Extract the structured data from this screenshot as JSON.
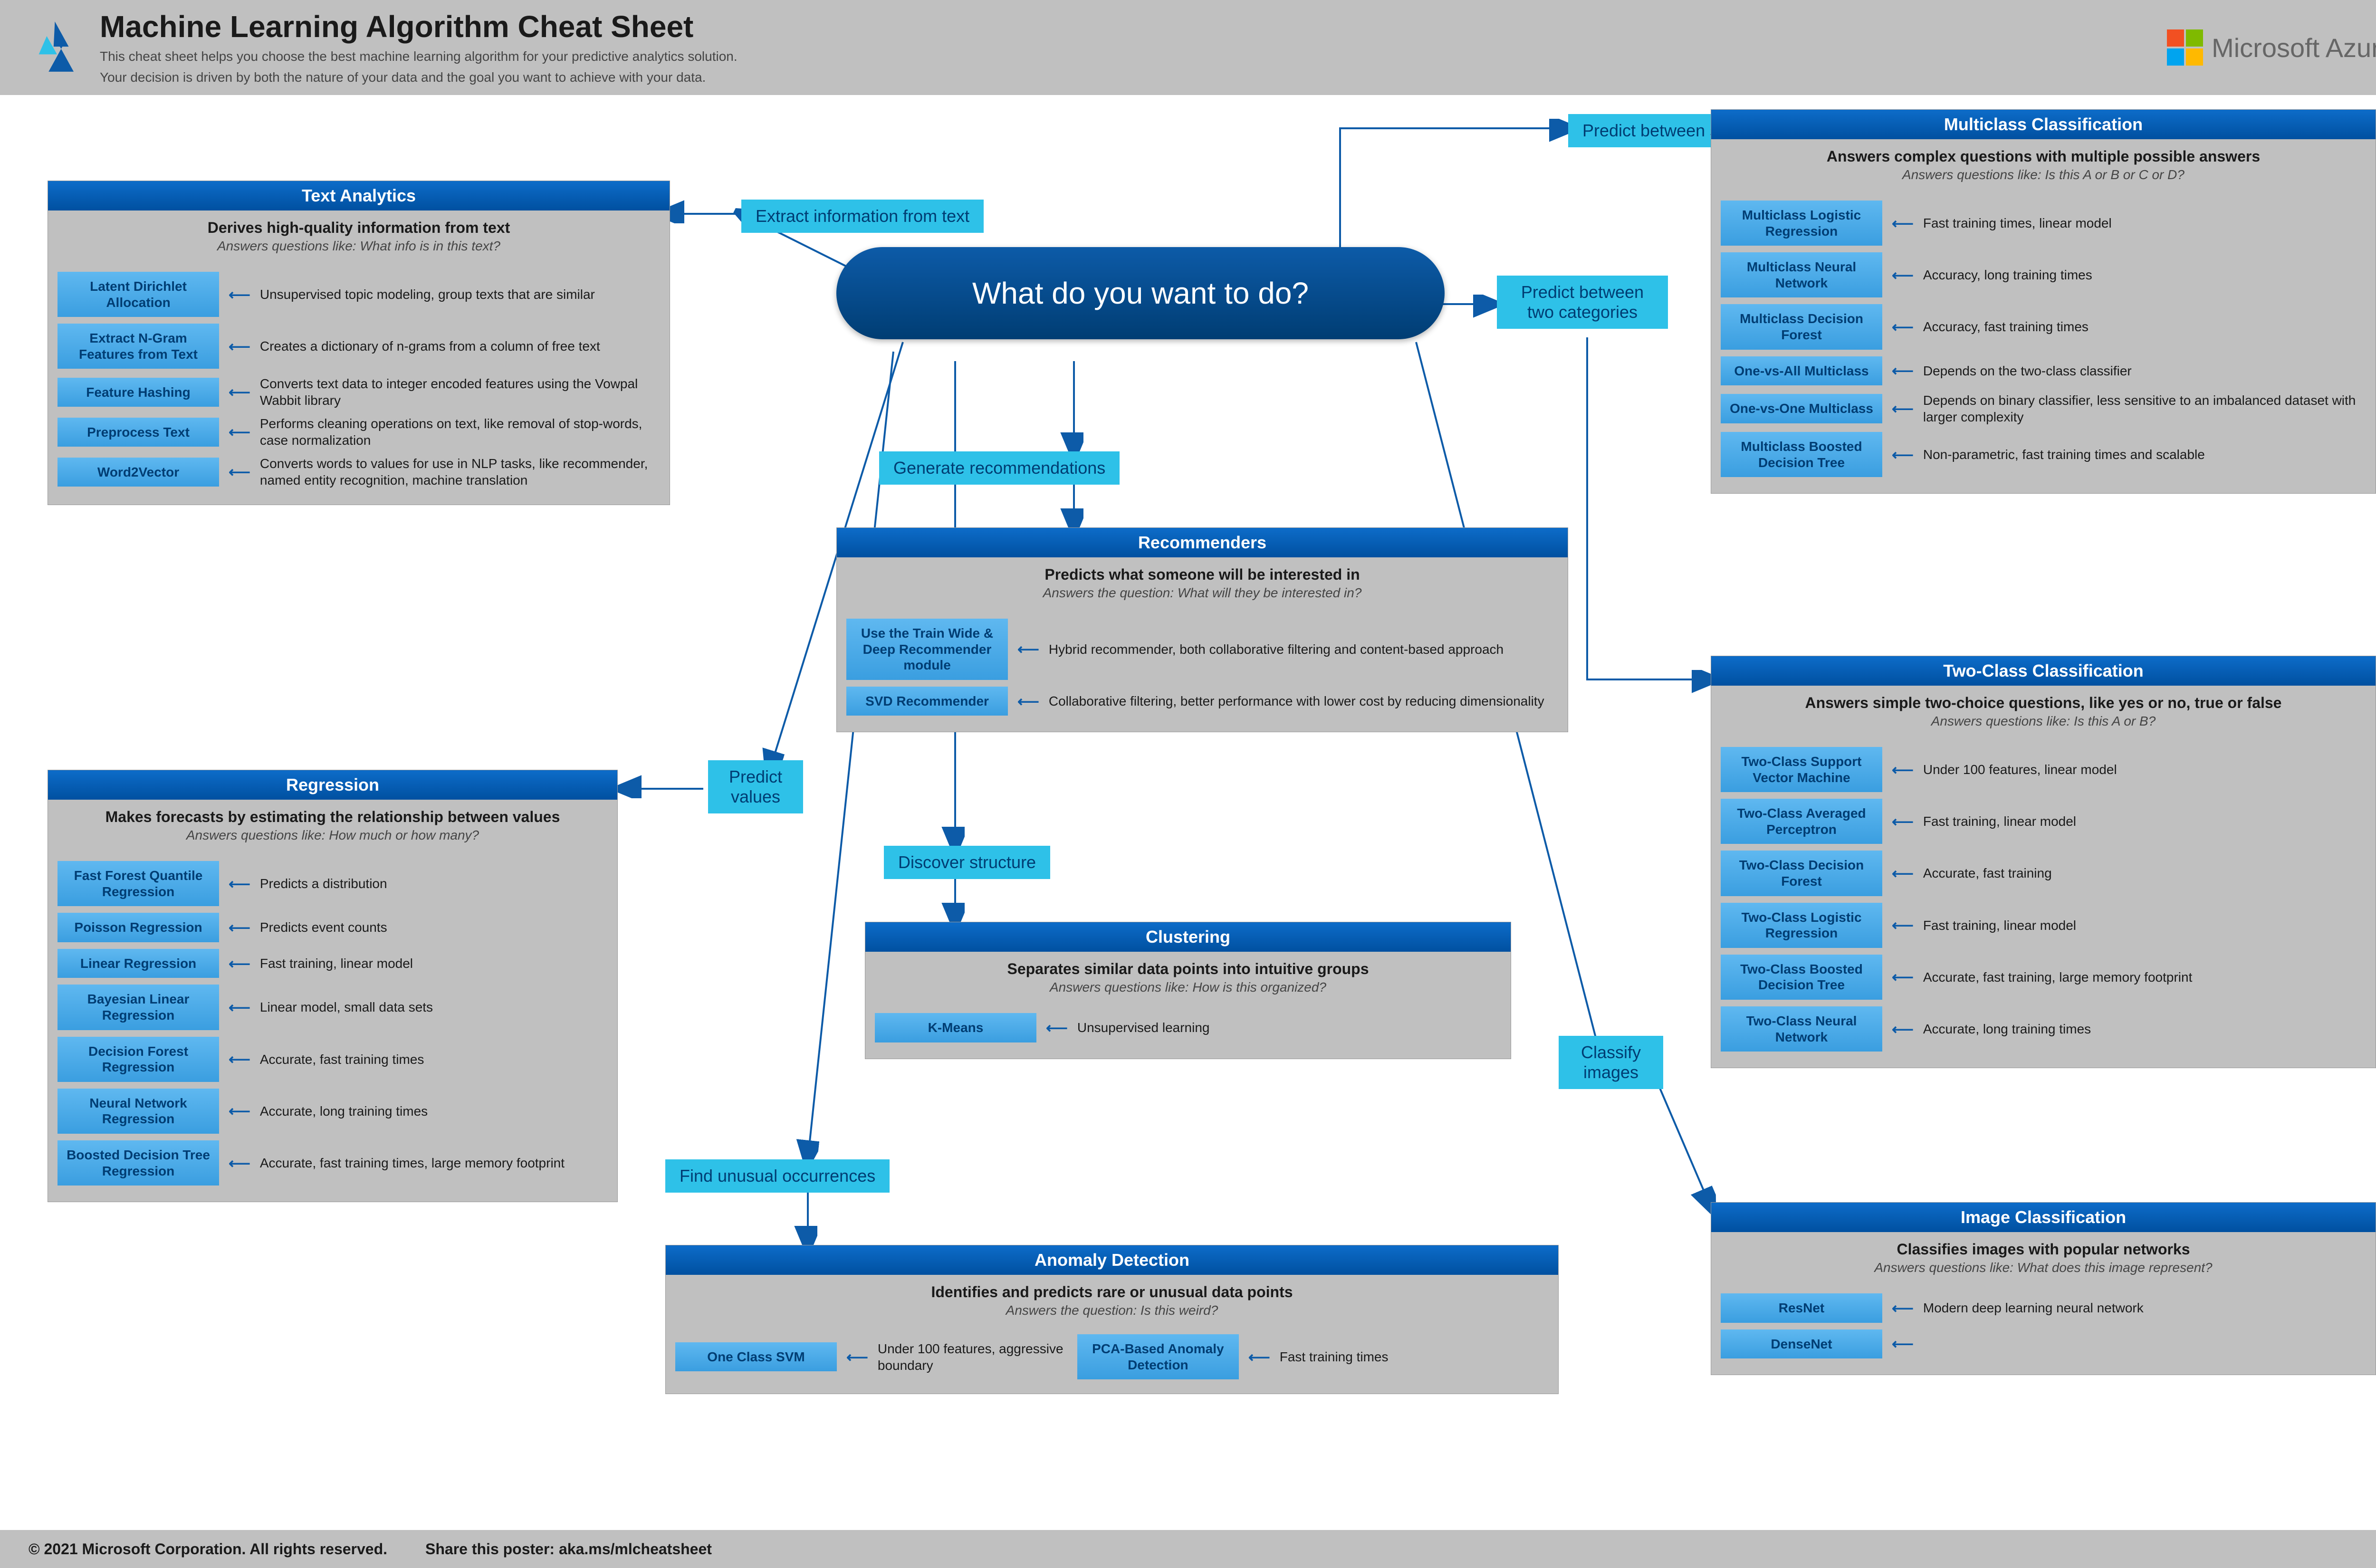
{
  "header": {
    "title": "Machine Learning Algorithm Cheat Sheet",
    "line1": "This cheat sheet helps you choose the best machine learning algorithm for your predictive analytics solution.",
    "line2": "Your decision is driven by both the nature of your data and the goal you want to achieve with your data.",
    "brand": "Microsoft Azure"
  },
  "center_question": "What do you want to do?",
  "branches": {
    "extract_text": "Extract information from text",
    "predict_multi": "Predict between several categories",
    "predict_two": "Predict between two categories",
    "recommend": "Generate recommendations",
    "predict_values": "Predict values",
    "discover": "Discover structure",
    "unusual": "Find unusual occurrences",
    "classify_img": "Classify images"
  },
  "cats": {
    "text_analytics": {
      "title": "Text Analytics",
      "sub": "Derives high-quality information from text",
      "q": "Answers questions like: What info is in this text?",
      "items": [
        {
          "name": "Latent Dirichlet Allocation",
          "desc": "Unsupervised topic modeling, group texts that are similar"
        },
        {
          "name": "Extract N-Gram Features from Text",
          "desc": "Creates a dictionary of n-grams from a column of free text"
        },
        {
          "name": "Feature Hashing",
          "desc": "Converts text data to integer encoded features using the Vowpal Wabbit library"
        },
        {
          "name": "Preprocess Text",
          "desc": "Performs cleaning operations on text, like removal of stop-words, case normalization"
        },
        {
          "name": "Word2Vector",
          "desc": "Converts words to values for use in NLP tasks, like recommender, named entity recognition, machine translation"
        }
      ]
    },
    "multiclass": {
      "title": "Multiclass Classification",
      "sub": "Answers complex questions with multiple possible answers",
      "q": "Answers questions like: Is this A or B or C or D?",
      "items": [
        {
          "name": "Multiclass Logistic Regression",
          "desc": "Fast training times, linear model"
        },
        {
          "name": "Multiclass Neural Network",
          "desc": "Accuracy, long training times"
        },
        {
          "name": "Multiclass Decision Forest",
          "desc": "Accuracy, fast training times"
        },
        {
          "name": "One-vs-All Multiclass",
          "desc": "Depends on the two-class classifier"
        },
        {
          "name": "One-vs-One Multiclass",
          "desc": "Depends on binary classifier, less sensitive to an imbalanced dataset with larger complexity"
        },
        {
          "name": "Multiclass Boosted Decision Tree",
          "desc": "Non-parametric, fast training times and scalable"
        }
      ]
    },
    "twoclass": {
      "title": "Two-Class Classification",
      "sub": "Answers simple two-choice questions, like yes or no, true or false",
      "q": "Answers questions like: Is this A or B?",
      "items": [
        {
          "name": "Two-Class Support Vector Machine",
          "desc": "Under 100 features, linear model"
        },
        {
          "name": "Two-Class Averaged Perceptron",
          "desc": "Fast training, linear model"
        },
        {
          "name": "Two-Class Decision Forest",
          "desc": "Accurate, fast training"
        },
        {
          "name": "Two-Class Logistic Regression",
          "desc": "Fast training, linear model"
        },
        {
          "name": "Two-Class Boosted Decision Tree",
          "desc": "Accurate, fast training, large memory footprint"
        },
        {
          "name": "Two-Class Neural Network",
          "desc": "Accurate, long training times"
        }
      ]
    },
    "recommenders": {
      "title": "Recommenders",
      "sub": "Predicts what someone will be interested in",
      "q": "Answers the question: What will they be interested in?",
      "items": [
        {
          "name": "Use the Train Wide & Deep Recommender module",
          "desc": "Hybrid recommender, both collaborative filtering and content-based approach"
        },
        {
          "name": "SVD Recommender",
          "desc": "Collaborative filtering, better performance with lower cost by reducing dimensionality"
        }
      ]
    },
    "clustering": {
      "title": "Clustering",
      "sub": "Separates similar data points into intuitive groups",
      "q": "Answers questions like: How is this organized?",
      "items": [
        {
          "name": "K-Means",
          "desc": "Unsupervised learning"
        }
      ]
    },
    "anomaly": {
      "title": "Anomaly Detection",
      "sub": "Identifies and predicts rare or unusual data points",
      "q": "Answers the question: Is this weird?",
      "items": [
        {
          "name": "One Class SVM",
          "desc": "Under 100 features, aggressive boundary"
        },
        {
          "name": "PCA-Based Anomaly Detection",
          "desc": "Fast training times"
        }
      ]
    },
    "regression": {
      "title": "Regression",
      "sub": "Makes forecasts by estimating the relationship between values",
      "q": "Answers questions like: How much or how many?",
      "items": [
        {
          "name": "Fast Forest Quantile Regression",
          "desc": "Predicts a distribution"
        },
        {
          "name": "Poisson Regression",
          "desc": "Predicts event counts"
        },
        {
          "name": "Linear Regression",
          "desc": "Fast training, linear model"
        },
        {
          "name": "Bayesian Linear Regression",
          "desc": "Linear model, small data sets"
        },
        {
          "name": "Decision Forest Regression",
          "desc": "Accurate, fast training times"
        },
        {
          "name": "Neural Network Regression",
          "desc": "Accurate, long training times"
        },
        {
          "name": "Boosted Decision Tree Regression",
          "desc": "Accurate, fast training times, large memory footprint"
        }
      ]
    },
    "image": {
      "title": "Image Classification",
      "sub": "Classifies images with popular networks",
      "q": "Answers questions like: What does this image represent?",
      "items": [
        {
          "name": "ResNet",
          "desc": "Modern deep learning neural network"
        },
        {
          "name": "DenseNet",
          "desc": ""
        }
      ]
    }
  },
  "footer": {
    "copyright": "© 2021 Microsoft Corporation. All rights reserved.",
    "share": "Share this poster: aka.ms/mlcheatsheet"
  }
}
